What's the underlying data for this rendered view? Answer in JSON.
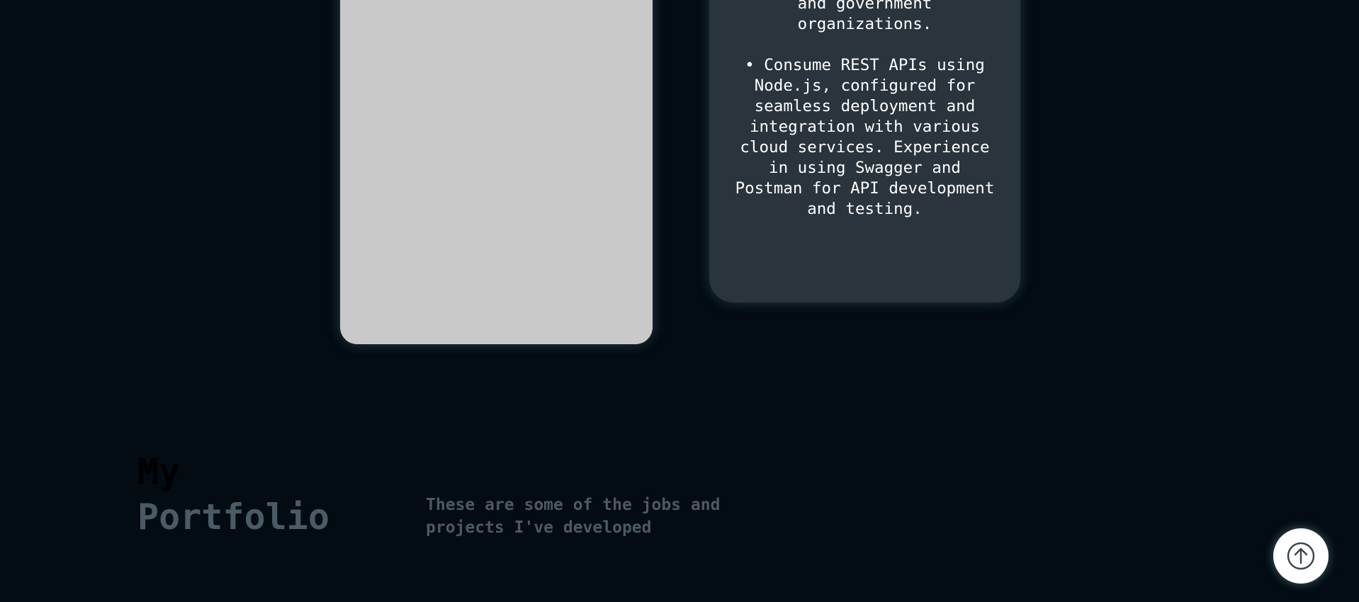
{
  "experience": {
    "paragraph_1": "for a variety of businesses\nand government\norganizations.",
    "paragraph_2": "• Consume REST APIs using\nNode.js, configured for\nseamless deployment and\nintegration with various\ncloud services. Experience\nin using Swagger and\nPostman for API development\nand testing."
  },
  "portfolio": {
    "title_line_1": "My",
    "title_line_2": "Portfolio",
    "subtitle": "These are some of the jobs and projects I've developed"
  },
  "scroll_top": {
    "icon": "arrow-up-circle-icon"
  }
}
